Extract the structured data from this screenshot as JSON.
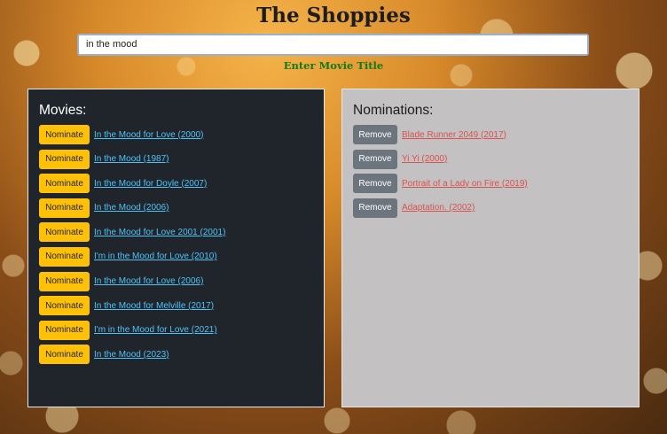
{
  "header": {
    "title": "The Shoppies"
  },
  "search": {
    "value": "in the mood",
    "label": "Enter Movie Title"
  },
  "movies": {
    "heading": "Movies:",
    "button_label": "Nominate",
    "items": [
      "In the Mood for Love (2000)",
      "In the Mood (1987)",
      "In the Mood for Doyle (2007)",
      "In the Mood (2006)",
      "In the Mood for Love 2001 (2001)",
      "I'm in the Mood for Love (2010)",
      "In the Mood for Love (2006)",
      "In the Mood for Melville (2017)",
      "I'm in the Mood for Love (2021)",
      "In the Mood (2023)"
    ]
  },
  "nominations": {
    "heading": "Nominations:",
    "button_label": "Remove",
    "items": [
      "Blade Runner 2049 (2017)",
      "Yi Yi (2000)",
      "Portrait of a Lady on Fire (2019)",
      "Adaptation. (2002)"
    ]
  },
  "colors": {
    "nominate_button": "#ffc107",
    "remove_button": "#6c757d",
    "movie_link": "#4fc3f7",
    "nomination_link": "#d9534f",
    "search_label": "#117a11"
  }
}
